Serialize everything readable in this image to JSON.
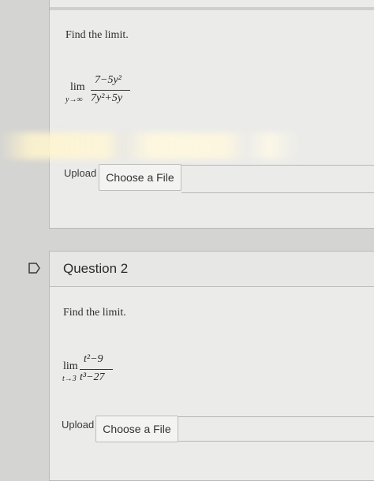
{
  "question1": {
    "prompt": "Find the limit.",
    "lim": "lim",
    "subscript": "y→∞",
    "numerator": "7−5y²",
    "denominator": "7y²+5y",
    "upload_label": "Upload",
    "choose_file_label": "Choose a File"
  },
  "question2": {
    "title": "Question 2",
    "prompt": "Find the limit.",
    "lim": "lim",
    "subscript": "t→3",
    "numerator": "t²−9",
    "denominator": "t³−27",
    "upload_label": "Upload",
    "choose_file_label": "Choose a File"
  },
  "icons": {
    "flag": "flag-outline-icon"
  },
  "colors": {
    "page_bg": "#d4d4d2",
    "card_bg": "#ebebea",
    "border": "#b9b9b7"
  }
}
